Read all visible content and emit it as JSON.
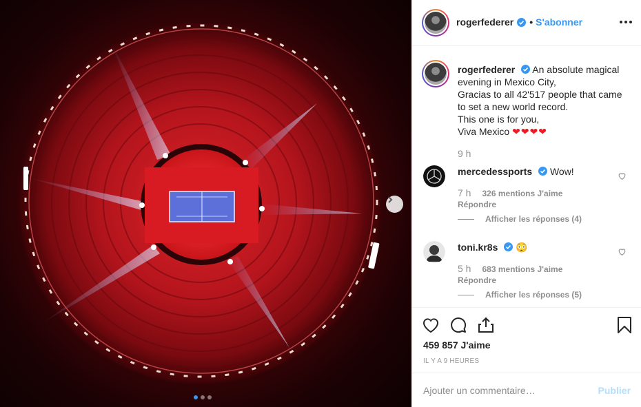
{
  "post": {
    "username": "rogerfederer",
    "follow_label": "S'abonner",
    "separator": "•",
    "caption_lines": [
      "An absolute magical",
      "evening in Mexico City,",
      "Gracias to all 42'517 people that came",
      "to set a new world record.",
      "This one is for you,",
      "Viva Mexico"
    ],
    "caption_hearts": "❤❤❤❤",
    "caption_time": "9 h",
    "likes": "459 857 J'aime",
    "time_ago": "IL Y A 9 HEURES",
    "comment_placeholder": "Ajouter un commentaire…",
    "publish_label": "Publier"
  },
  "comments": [
    {
      "username": "mercedessports",
      "text": "Wow!",
      "time": "7 h",
      "likes": "326 mentions J'aime",
      "reply_label": "Répondre",
      "view_replies": "Afficher les réponses (4)"
    },
    {
      "username": "toni.kr8s",
      "text": "😳",
      "time": "5 h",
      "likes": "683 mentions J'aime",
      "reply_label": "Répondre",
      "view_replies": "Afficher les réponses (5)"
    }
  ],
  "carousel": {
    "current": 1,
    "total": 3
  },
  "icons": {
    "verified": "verified-badge-icon",
    "more": "more-options-icon",
    "like": "heart-icon",
    "comment": "comment-icon",
    "share": "share-icon",
    "save": "bookmark-icon",
    "next": "chevron-right-icon"
  },
  "colors": {
    "accent": "#3897f0",
    "publish_disabled": "#b2dffc",
    "heart": "#ed1c24"
  }
}
